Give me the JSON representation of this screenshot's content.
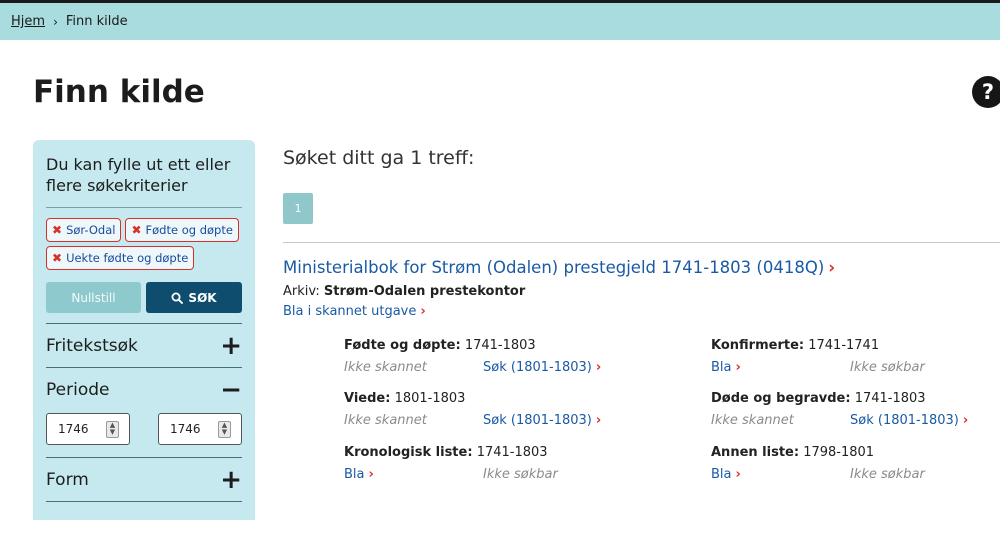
{
  "breadcrumb": {
    "home": "Hjem",
    "separator": "›",
    "current": "Finn kilde"
  },
  "page": {
    "title": "Finn kilde",
    "help": "?"
  },
  "sidebar": {
    "intro": "Du kan fylle ut ett eller flere søkekriterier",
    "chips": [
      "Sør-Odal",
      "Fødte og døpte",
      "Uekte fødte og døpte"
    ],
    "chip_remove_glyph": "✖",
    "reset_label": "Nullstill",
    "search_label": "SØK",
    "sections": {
      "fritekst": {
        "label": "Fritekstsøk",
        "sign": "+"
      },
      "periode": {
        "label": "Periode",
        "sign": "−",
        "from": "1746",
        "to": "1746"
      },
      "form": {
        "label": "Form",
        "sign": "+"
      }
    }
  },
  "results": {
    "summary": "Søket ditt ga 1 treff:",
    "page": "1",
    "record": {
      "title": "Ministerialbok for Strøm (Odalen) prestegjeld 1741-1803 (0418Q)",
      "archive_label": "Arkiv:",
      "archive_value": "Strøm-Odalen prestekontor",
      "scan_link": "Bla i skannet utgave",
      "chevron": "›",
      "lists": [
        {
          "name": "Fødte og døpte:",
          "years": "1741-1803",
          "a": "Ikke skannet",
          "a_link": false,
          "b": "Søk (1801-1803)",
          "b_link": true
        },
        {
          "name": "Konfirmerte:",
          "years": "1741-1741",
          "a": "Bla",
          "a_link": true,
          "b": "Ikke søkbar",
          "b_link": false
        },
        {
          "name": "Viede:",
          "years": "1801-1803",
          "a": "Ikke skannet",
          "a_link": false,
          "b": "Søk (1801-1803)",
          "b_link": true
        },
        {
          "name": "Døde og begravde:",
          "years": "1741-1803",
          "a": "Ikke skannet",
          "a_link": false,
          "b": "Søk (1801-1803)",
          "b_link": true
        },
        {
          "name": "Kronologisk liste:",
          "years": "1741-1803",
          "a": "Bla",
          "a_link": true,
          "b": "Ikke søkbar",
          "b_link": false
        },
        {
          "name": "Annen liste:",
          "years": "1798-1801",
          "a": "Bla",
          "a_link": true,
          "b": "Ikke søkbar",
          "b_link": false
        }
      ]
    }
  },
  "colors": {
    "accent_bar": "#a9dcde",
    "sidebar_bg": "#c5e9ef",
    "link": "#1a5aa5",
    "danger": "#d9302c",
    "primary_button": "#0f4d6f"
  }
}
